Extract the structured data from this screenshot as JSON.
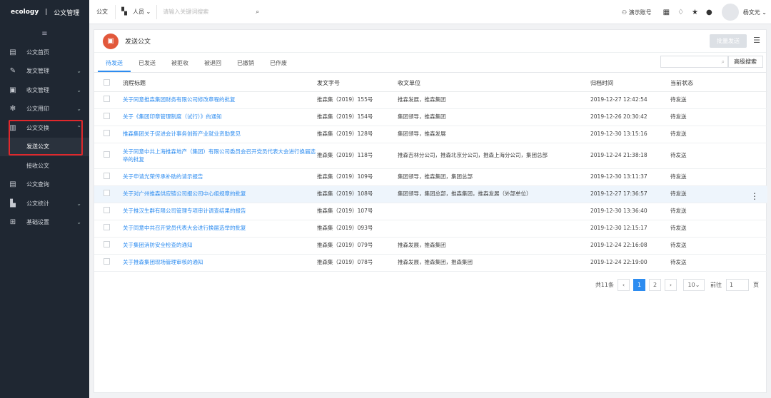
{
  "app": {
    "brand": "ecology",
    "separator": "|",
    "module": "公文管理"
  },
  "sidebar": {
    "collapse_icon": "≡",
    "items": [
      {
        "label": "公文首页",
        "icon": "list-icon"
      },
      {
        "label": "发文管理",
        "icon": "edit-icon",
        "chevron": "⌄"
      },
      {
        "label": "收文管理",
        "icon": "inbox-icon",
        "chevron": "⌄"
      },
      {
        "label": "公文用印",
        "icon": "seal-icon",
        "chevron": "⌄"
      },
      {
        "label": "公文交换",
        "icon": "exchange-icon",
        "chevron": "⌃"
      },
      {
        "label": "发送公文",
        "sub": true,
        "active": true
      },
      {
        "label": "接收公文",
        "sub": true
      },
      {
        "label": "公文查询",
        "icon": "query-icon"
      },
      {
        "label": "公文统计",
        "icon": "stats-icon",
        "chevron": "⌄"
      },
      {
        "label": "基础设置",
        "icon": "settings-icon",
        "chevron": "⌄"
      }
    ]
  },
  "topbar": {
    "module_label": "公文",
    "scope_label": "人员",
    "search_placeholder": "请输入关键词搜索",
    "account_label": "演示账号",
    "user_name": "杨文元"
  },
  "page": {
    "title": "发送公文",
    "batch_button": "批量发送",
    "tabs": [
      "待发送",
      "已发送",
      "被拒收",
      "被退回",
      "已撤销",
      "已作废"
    ],
    "active_tab": 0,
    "advanced_search": "高级搜索"
  },
  "table": {
    "columns": [
      "流程标题",
      "发文字号",
      "收文单位",
      "归档时间",
      "当前状态"
    ],
    "rows": [
      {
        "title": "关于同意推森集团财务有限公司修改章程的批复",
        "number": "推森集（2019）155号",
        "units": "推森发展，推森集团",
        "time": "2019-12-27 12:42:54",
        "status": "待发送"
      },
      {
        "title": "关于《集团印章管理制度（试行）》的通知",
        "number": "推森集（2019）154号",
        "units": "集团领导，推森集团",
        "time": "2019-12-26 20:30:42",
        "status": "待发送"
      },
      {
        "title": "推森集团关于促进会计事务创新产业就业资助意见",
        "number": "推森集（2019）128号",
        "units": "集团领导，推森发展",
        "time": "2019-12-30 13:15:16",
        "status": "待发送"
      },
      {
        "title": "关于同意中共上海推森地产（集团）有限公司委员会召开党员代表大会进行换届选举的批复",
        "number": "推森集（2019）118号",
        "units": "推森吉林分公司，推森北京分公司，推森上海分公司，集团总部",
        "time": "2019-12-24 21:38:18",
        "status": "待发送",
        "tall": true
      },
      {
        "title": "关于申请光荣传承补助的请示报告",
        "number": "推森集（2019）109号",
        "units": "集团领导，推森集团，集团总部",
        "time": "2019-12-30 13:11:37",
        "status": "待发送"
      },
      {
        "title": "关于对广州推森供应链公司报公司中心组规章的批复",
        "number": "推森集（2019）108号",
        "units": "集团领导，集团总部，推森集团，推森发展（外部单位）",
        "time": "2019-12-27 17:36:57",
        "status": "待发送",
        "hover": true
      },
      {
        "title": "关于推汉生群有限公司管理专项审计调查结果的报告",
        "number": "推森集（2019）107号",
        "units": "",
        "time": "2019-12-30 13:36:40",
        "status": "待发送"
      },
      {
        "title": "关于同意中共召开党员代表大会进行换届选举的批复",
        "number": "推森集（2019）093号",
        "units": "",
        "time": "2019-12-30 12:15:17",
        "status": "待发送"
      },
      {
        "title": "关于集团消防安全检查的通知",
        "number": "推森集（2019）079号",
        "units": "推森发展，推森集团",
        "time": "2019-12-24 22:16:08",
        "status": "待发送"
      },
      {
        "title": "关于推森集团现场管理审核的通知",
        "number": "推森集（2019）078号",
        "units": "推森发展，推森集团，推森集团",
        "time": "2019-12-24 22:19:00",
        "status": "待发送"
      }
    ]
  },
  "pager": {
    "total": "共11条",
    "prev": "‹",
    "pages": [
      "1",
      "2"
    ],
    "current": "1",
    "next": "›",
    "size": "10",
    "size_suffix": "⌄",
    "goto_label": "前往",
    "goto_value": "1",
    "goto_suffix": "页"
  }
}
